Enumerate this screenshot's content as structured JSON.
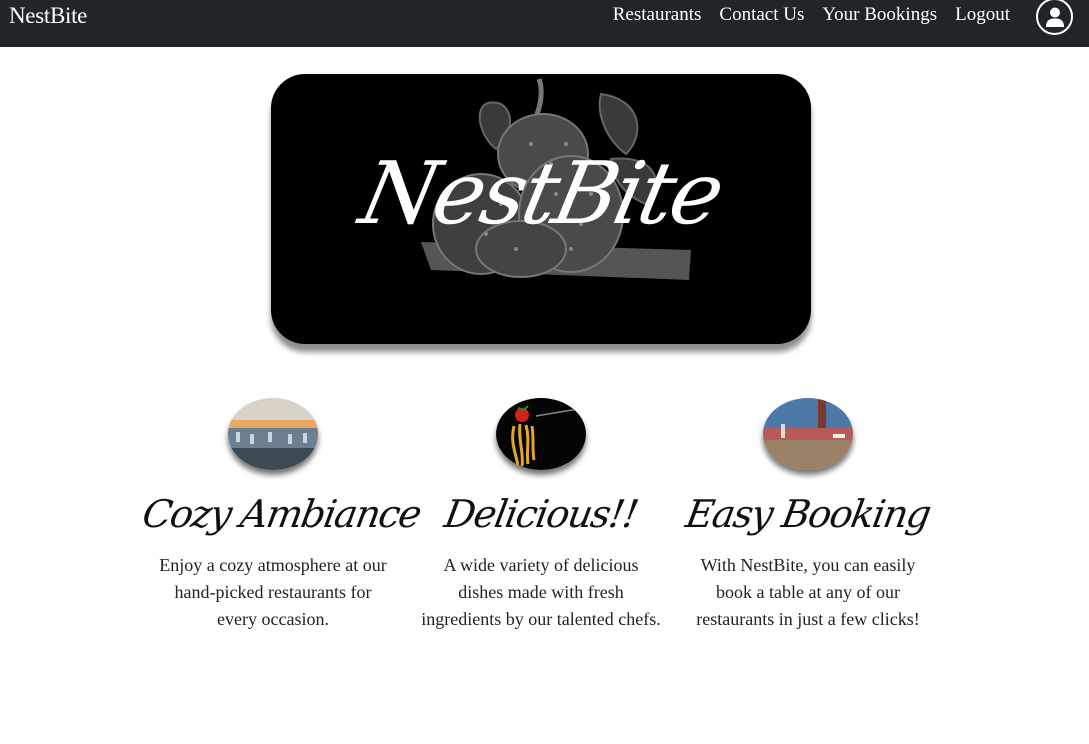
{
  "navbar": {
    "brand": "NestBite",
    "links": [
      "Restaurants",
      "Contact Us",
      "Your Bookings",
      "Logout"
    ],
    "user_icon": "user-circle-icon"
  },
  "hero": {
    "title": "NestBite",
    "background_icon": "strawberry-illustration"
  },
  "features": [
    {
      "title": "Cozy Ambiance",
      "text": "Enjoy a cozy atmosphere at our hand-picked restaurants for every occasion.",
      "image": "restaurant-terrace-photo"
    },
    {
      "title": "Delicious!!",
      "text": "A wide variety of delicious dishes made with fresh ingredients by our talented chefs.",
      "image": "spaghetti-fork-photo"
    },
    {
      "title": "Easy Booking",
      "text": "With NestBite, you can easily book a table at any of our restaurants in just a few clicks!",
      "image": "restaurant-table-photo"
    }
  ],
  "colors": {
    "navbar_bg": "#212529",
    "hero_bg": "#000000",
    "text": "#222222"
  }
}
